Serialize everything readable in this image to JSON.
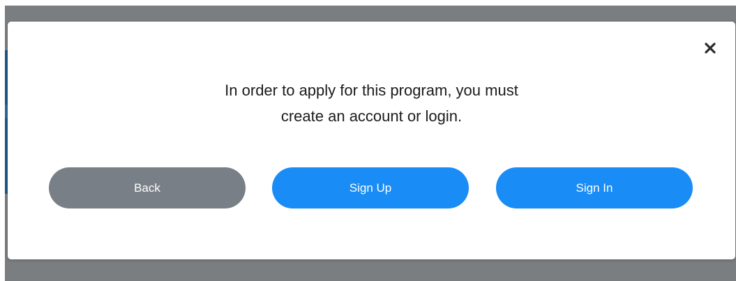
{
  "modal": {
    "message_line1": "In order to apply for this program, you must",
    "message_line2": "create an account or login.",
    "close_icon": "close-icon",
    "buttons": {
      "back": "Back",
      "sign_up": "Sign Up",
      "sign_in": "Sign In"
    }
  },
  "colors": {
    "backdrop": "#7b7e80",
    "back_button": "#787f86",
    "primary_button": "#1a8cf5",
    "text": "#1b1b1b"
  }
}
